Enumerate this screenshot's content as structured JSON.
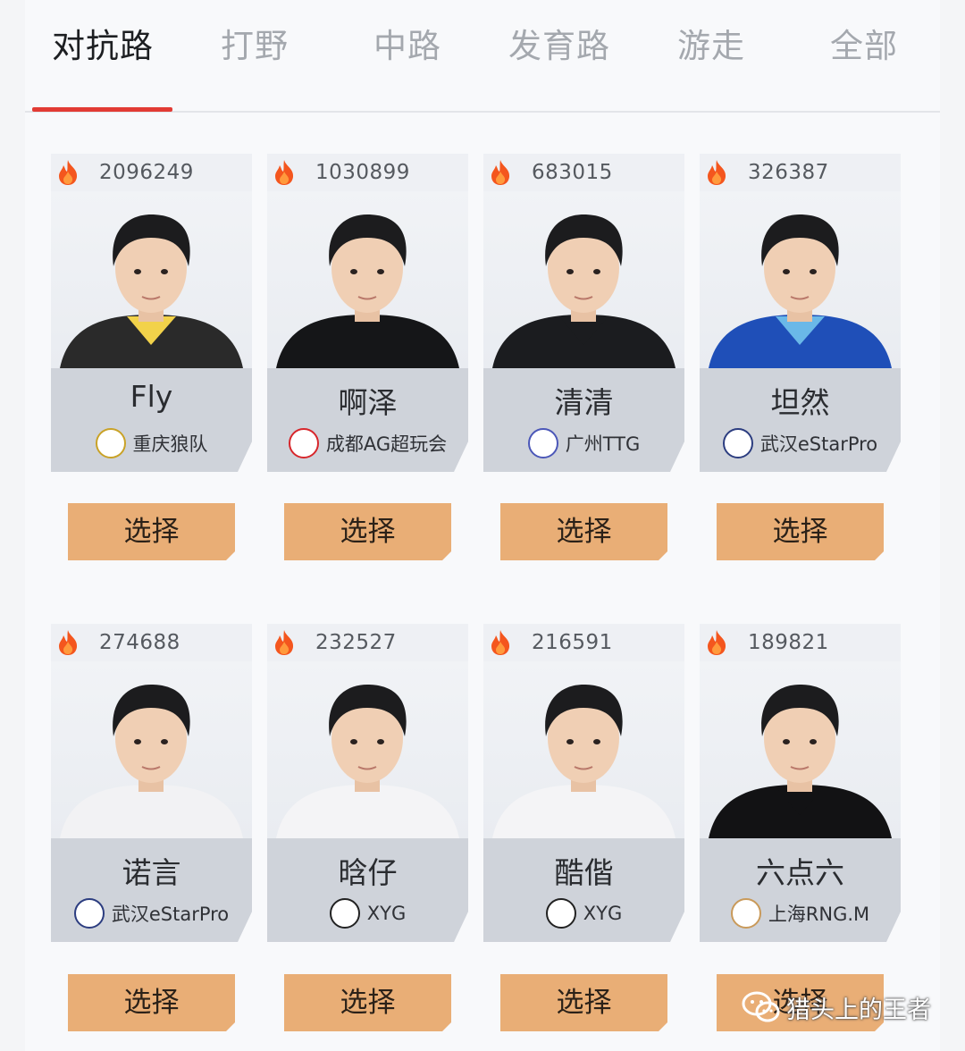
{
  "tabs": [
    {
      "label": "对抗路",
      "active": true
    },
    {
      "label": "打野",
      "active": false
    },
    {
      "label": "中路",
      "active": false
    },
    {
      "label": "发育路",
      "active": false
    },
    {
      "label": "游走",
      "active": false
    },
    {
      "label": "全部",
      "active": false
    }
  ],
  "colors": {
    "accent": "#e23b34",
    "button": "#e9ae76",
    "fire": "#f4561e",
    "info_band": "#cfd3da"
  },
  "icons": {
    "heat": "fire-icon",
    "team": "team-logo-icon",
    "watermark": "wechat-icon"
  },
  "players": [
    {
      "heat": "2096249",
      "name": "Fly",
      "team": "重庆狼队",
      "button": "选择",
      "logo_color": "#c9a227",
      "shirt": "#2a2a2a",
      "collar": "#f2d24a"
    },
    {
      "heat": "1030899",
      "name": "啊泽",
      "team": "成都AG超玩会",
      "button": "选择",
      "logo_color": "#d7262b",
      "shirt": "#151618",
      "collar": "#151618"
    },
    {
      "heat": "683015",
      "name": "清清",
      "team": "广州TTG",
      "button": "选择",
      "logo_color": "#4b57b8",
      "shirt": "#1b1c1f",
      "collar": "#1b1c1f"
    },
    {
      "heat": "326387",
      "name": "坦然",
      "team": "武汉eStarPro",
      "button": "选择",
      "logo_color": "#2c3d80",
      "shirt": "#1f4fb8",
      "collar": "#6ab8e8"
    },
    {
      "heat": "274688",
      "name": "诺言",
      "team": "武汉eStarPro",
      "button": "选择",
      "logo_color": "#2c3d80",
      "shirt": "#f2f2f4",
      "collar": "#f2f2f4"
    },
    {
      "heat": "232527",
      "name": "晗仔",
      "team": "XYG",
      "button": "选择",
      "logo_color": "#222222",
      "shirt": "#f4f4f6",
      "collar": "#f4f4f6"
    },
    {
      "heat": "216591",
      "name": "酷偕",
      "team": "XYG",
      "button": "选择",
      "logo_color": "#222222",
      "shirt": "#f4f4f6",
      "collar": "#f4f4f6"
    },
    {
      "heat": "189821",
      "name": "六点六",
      "team": "上海RNG.M",
      "button": "选择",
      "logo_color": "#c99a5a",
      "shirt": "#121214",
      "collar": "#121214"
    }
  ],
  "watermark": {
    "text": "猎头上的王者"
  }
}
